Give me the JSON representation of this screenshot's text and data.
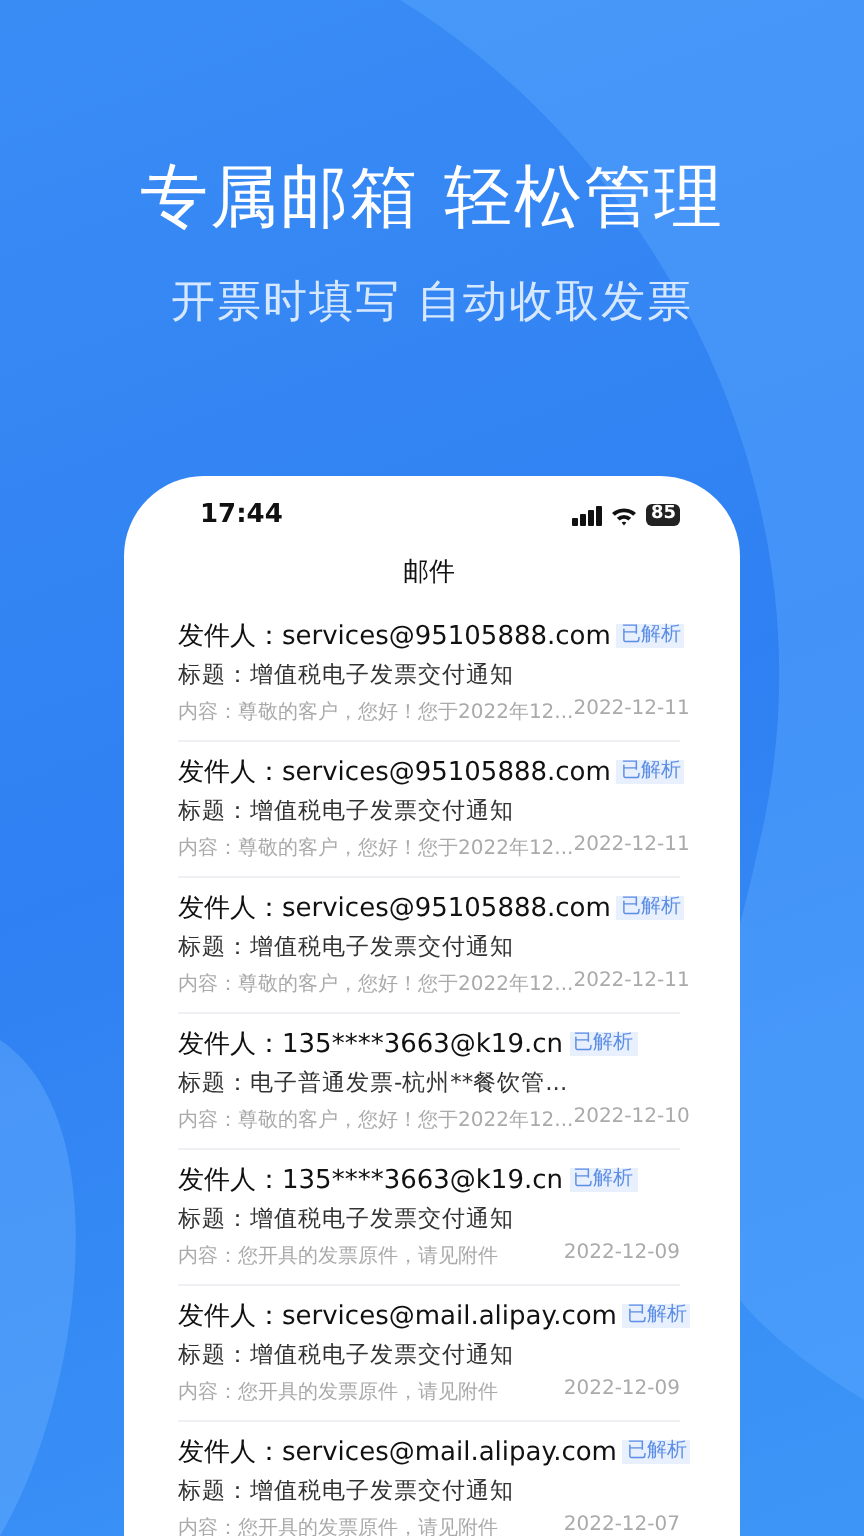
{
  "headline": "专属邮箱 轻松管理",
  "subheadline": "开票时填写 自动收取发票",
  "phone": {
    "status_bar": {
      "time": "17:44",
      "battery": "85"
    },
    "title": "邮件",
    "mails": [
      {
        "sender": "发件人：services@95105888.com",
        "badge": "已解析",
        "subject": "标题：增值税电子发票交付通知",
        "preview": "内容：尊敬的客户，您好！您于2022年12...",
        "date": "2022-12-11"
      },
      {
        "sender": "发件人：services@95105888.com",
        "badge": "已解析",
        "subject": "标题：增值税电子发票交付通知",
        "preview": "内容：尊敬的客户，您好！您于2022年12...",
        "date": "2022-12-11"
      },
      {
        "sender": "发件人：services@95105888.com",
        "badge": "已解析",
        "subject": "标题：增值税电子发票交付通知",
        "preview": "内容：尊敬的客户，您好！您于2022年12...",
        "date": "2022-12-11"
      },
      {
        "sender": "发件人：135****3663@k19.cn",
        "badge": "已解析",
        "subject": "标题：电子普通发票-杭州**餐饮管...",
        "preview": "内容：尊敬的客户，您好！您于2022年12...",
        "date": "2022-12-10"
      },
      {
        "sender": "发件人：135****3663@k19.cn",
        "badge": "已解析",
        "subject": "标题：增值税电子发票交付通知",
        "preview": "内容：您开具的发票原件，请见附件",
        "date": "2022-12-09"
      },
      {
        "sender": "发件人：services@mail.alipay.com",
        "badge": "已解析",
        "subject": "标题：增值税电子发票交付通知",
        "preview": "内容：您开具的发票原件，请见附件",
        "date": "2022-12-09"
      },
      {
        "sender": "发件人：services@mail.alipay.com",
        "badge": "已解析",
        "subject": "标题：增值税电子发票交付通知",
        "preview": "内容：您开具的发票原件，请见附件",
        "date": "2022-12-07"
      }
    ]
  }
}
